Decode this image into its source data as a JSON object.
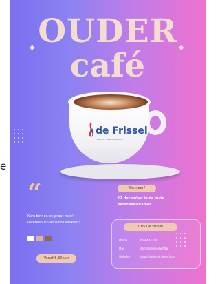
{
  "poster": {
    "title_line1": "OUDER",
    "title_line2": "café",
    "logo": {
      "name": "de Frissel",
      "tagline": "CBS De Frissel Fierachtrol"
    },
    "quote_mark": "“",
    "intro_line1": "Kom binnen en praat mee!",
    "intro_line2": "Iedereen is van harte welkom!",
    "when_label": "Wanneer?",
    "when_line1": "12 december in de oude",
    "when_line2": "personeelskamer",
    "from_time": "Vanaf 8.30 uur",
    "swatch_colors": [
      "#ffffff",
      "#d9b4a2",
      "#8f6a4f"
    ],
    "contact": {
      "name": "CBS De Frissel",
      "rows": [
        {
          "label": "Phone",
          "value": "059-474700"
        },
        {
          "label": "Mail",
          "value": "defrissel@fierachtrol"
        },
        {
          "label": "Website",
          "value": "http://defrissel.fierachtrol"
        }
      ]
    }
  },
  "side_fragment": "e"
}
